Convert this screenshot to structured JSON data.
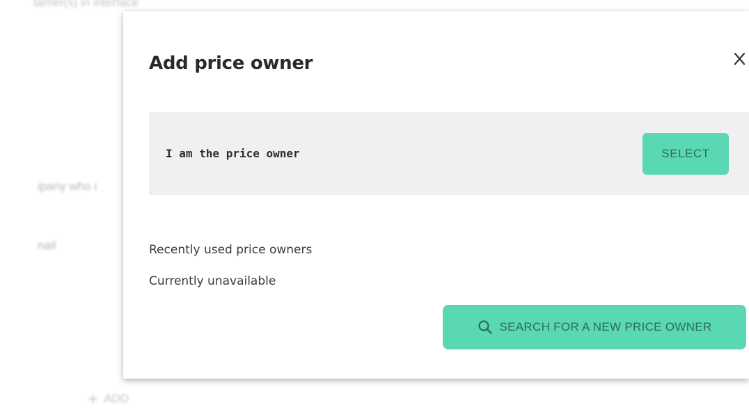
{
  "background": {
    "top_text": "tamer(s) in interface",
    "company_text": "ipany who i",
    "email_text": "nail",
    "add_label": "ADD"
  },
  "modal": {
    "title": "Add price owner",
    "owner_card": {
      "label": "I am the price owner",
      "select_label": "SELECT"
    },
    "recent_label": "Recently used price owners",
    "unavailable_label": "Currently unavailable",
    "search_button_label": "SEARCH FOR A NEW PRICE OWNER"
  },
  "colors": {
    "accent": "#5ad8b4",
    "accent_text": "#2d6a5a",
    "card_bg": "#f0f0f0"
  },
  "icons": {
    "close": "close-icon",
    "search": "search-icon",
    "plus": "plus-icon"
  }
}
